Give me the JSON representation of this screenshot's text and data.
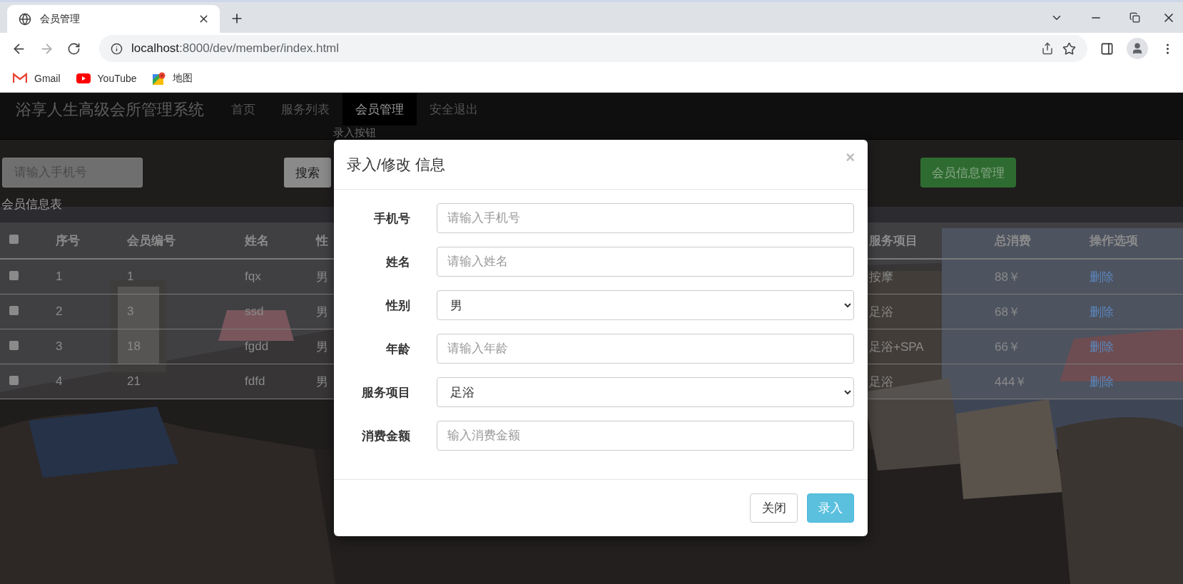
{
  "browser": {
    "tab": {
      "title": "会员管理"
    },
    "address": {
      "host": "localhost",
      "path": ":8000/dev/member/index.html"
    },
    "bookmarks": [
      {
        "label": "Gmail",
        "kind": "gmail"
      },
      {
        "label": "YouTube",
        "kind": "youtube"
      },
      {
        "label": "地图",
        "kind": "maps"
      }
    ]
  },
  "navbar": {
    "brand": "浴享人生高级会所管理系统",
    "items": [
      {
        "label": "首页",
        "selected": false
      },
      {
        "label": "服务列表",
        "selected": false
      },
      {
        "label": "会员管理",
        "selected": true
      },
      {
        "label": "安全退出",
        "selected": false
      }
    ]
  },
  "hint": "录入按钮",
  "search": {
    "placeholder": "请输入手机号",
    "button": "搜索"
  },
  "manage_button": "会员信息管理",
  "table": {
    "caption": "会员信息表",
    "all_checked": false,
    "columns": [
      "序号",
      "会员编号",
      "姓名",
      "性",
      "服务项目",
      "总消费",
      "操作选项"
    ],
    "rows": [
      {
        "checked": false,
        "cells": [
          "1",
          "1",
          "fqx",
          "男",
          "按摩",
          "88￥"
        ],
        "action": "删除"
      },
      {
        "checked": false,
        "cells": [
          "2",
          "3",
          "ssd",
          "男",
          "足浴",
          "68￥"
        ],
        "action": "删除"
      },
      {
        "checked": false,
        "cells": [
          "3",
          "18",
          "fgdd",
          "男",
          "足浴+SPA",
          "66￥"
        ],
        "action": "删除"
      },
      {
        "checked": false,
        "cells": [
          "4",
          "21",
          "fdfd",
          "男",
          "足浴",
          "444￥"
        ],
        "action": "删除"
      }
    ]
  },
  "modal": {
    "title": "录入/修改 信息",
    "close": "×",
    "fields": [
      {
        "label": "手机号",
        "kind": "input",
        "placeholder": "请输入手机号"
      },
      {
        "label": "姓名",
        "kind": "input",
        "placeholder": "请输入姓名"
      },
      {
        "label": "性别",
        "kind": "select",
        "value": "男"
      },
      {
        "label": "年龄",
        "kind": "input",
        "placeholder": "请输入年龄"
      },
      {
        "label": "服务项目",
        "kind": "select",
        "value": "足浴"
      },
      {
        "label": "消费金额",
        "kind": "input",
        "placeholder": "输入消费金额"
      }
    ],
    "buttons": [
      {
        "label": "关闭",
        "kind": "default"
      },
      {
        "label": "录入",
        "kind": "primary"
      }
    ]
  }
}
